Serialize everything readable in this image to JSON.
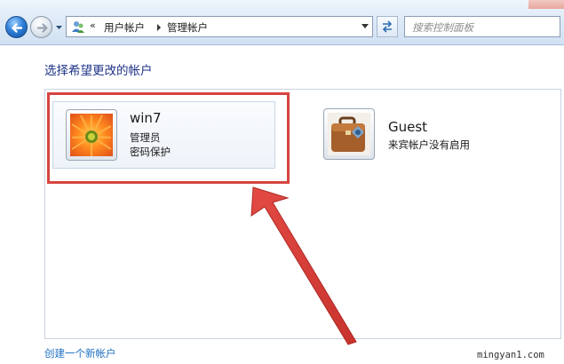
{
  "navigation": {
    "breadcrumb_overflow": "«",
    "breadcrumbs": [
      "用户帐户",
      "管理帐户"
    ],
    "search_placeholder": "搜索控制面板"
  },
  "main": {
    "heading": "选择希望更改的帐户",
    "accounts": [
      {
        "name": "win7",
        "lines": [
          "管理员",
          "密码保护"
        ],
        "avatar": "flower-avatar",
        "highlighted": true
      },
      {
        "name": "Guest",
        "lines": [
          "来宾帐户没有启用"
        ],
        "avatar": "suitcase-avatar",
        "highlighted": false
      }
    ],
    "create_link": "创建一个新帐户"
  },
  "annotation": {
    "color": "#d6443f"
  },
  "watermark": "mingyan1.com"
}
